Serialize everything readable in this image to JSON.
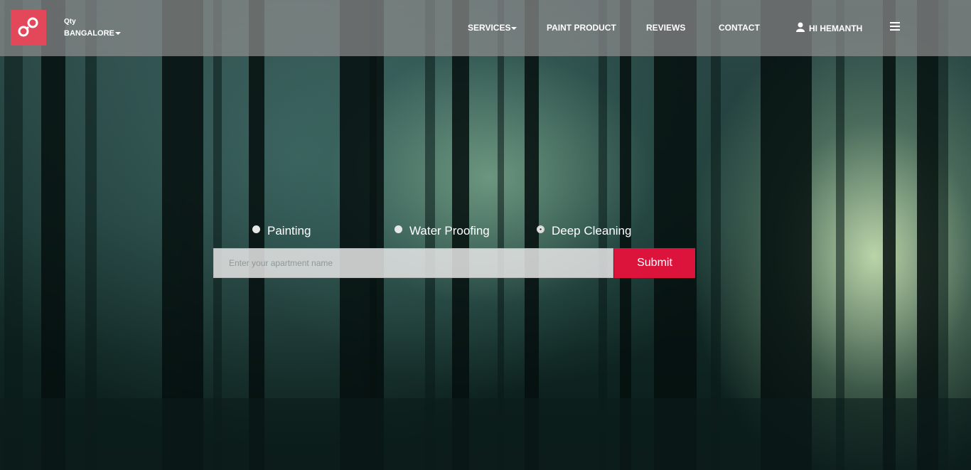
{
  "header": {
    "city_label": "Qty",
    "city_value": "BANGALORE",
    "nav": [
      {
        "label": "SERVICES",
        "has_caret": true
      },
      {
        "label": "PAINT PRODUCT"
      },
      {
        "label": "REVIEWS"
      },
      {
        "label": "CONTACT"
      }
    ],
    "user_greeting": "HI HEMANTH",
    "icons": {
      "logo": "brand-logo",
      "user": "user-icon",
      "menu": "hamburger-icon"
    }
  },
  "services": {
    "options": [
      {
        "label": "Painting",
        "checked": false
      },
      {
        "label": "Water Proofing",
        "checked": false
      },
      {
        "label": "Deep Cleaning",
        "checked": true
      }
    ]
  },
  "search": {
    "placeholder": "Enter your apartment name",
    "value": "",
    "submit_label": "Submit"
  },
  "colors": {
    "brand": "#e3485a",
    "submit": "#dc143c"
  }
}
